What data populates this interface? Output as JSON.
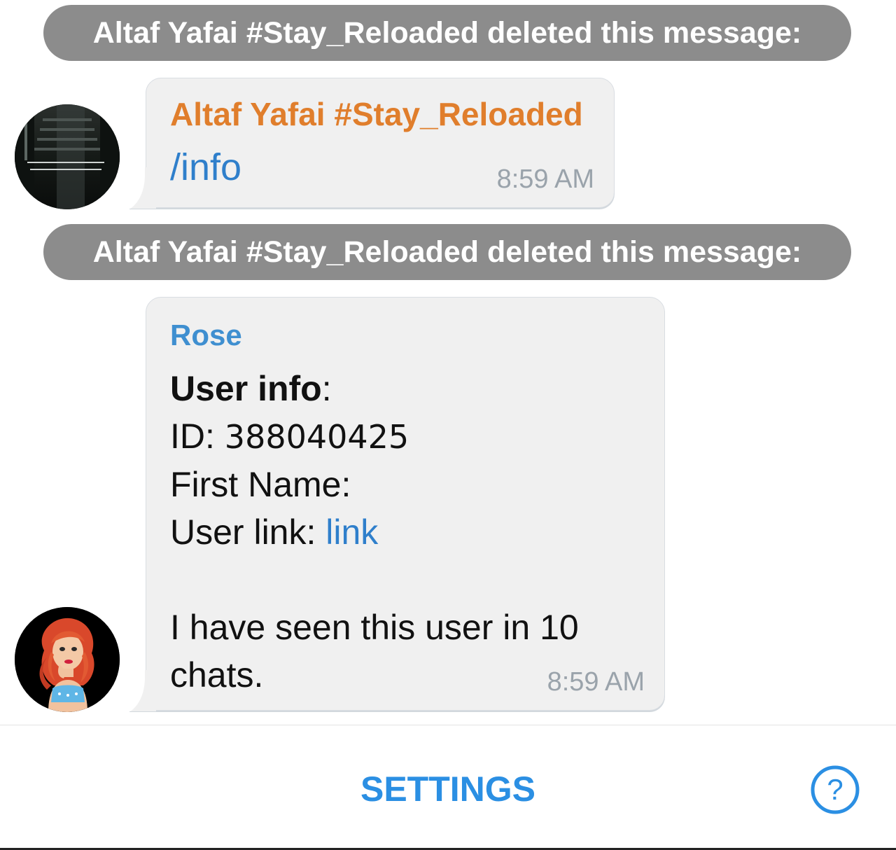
{
  "service_messages": [
    {
      "text": "Altaf Yafai #Stay_Reloaded deleted this message:"
    },
    {
      "text": "Altaf Yafai #Stay_Reloaded deleted this message:"
    }
  ],
  "messages": [
    {
      "sender": "Altaf Yafai #Stay_Reloaded",
      "sender_color": "#e07e2c",
      "text": "/info",
      "time": "8:59 AM"
    },
    {
      "sender": "Rose",
      "sender_color": "#3f8fd0",
      "info_title": "User info",
      "info_title_colon": ":",
      "id_label": "ID: ",
      "id_value": "388040425",
      "first_name_label": "First Name:",
      "user_link_label": "User link: ",
      "user_link_text": "link",
      "seen_line_1": "I have seen this user in 10",
      "seen_line_2": "chats.",
      "time": "8:59 AM"
    }
  ],
  "bottom_bar": {
    "settings_label": "SETTINGS",
    "help_icon": "question-circle-icon",
    "accent_color": "#2b8fe3"
  }
}
